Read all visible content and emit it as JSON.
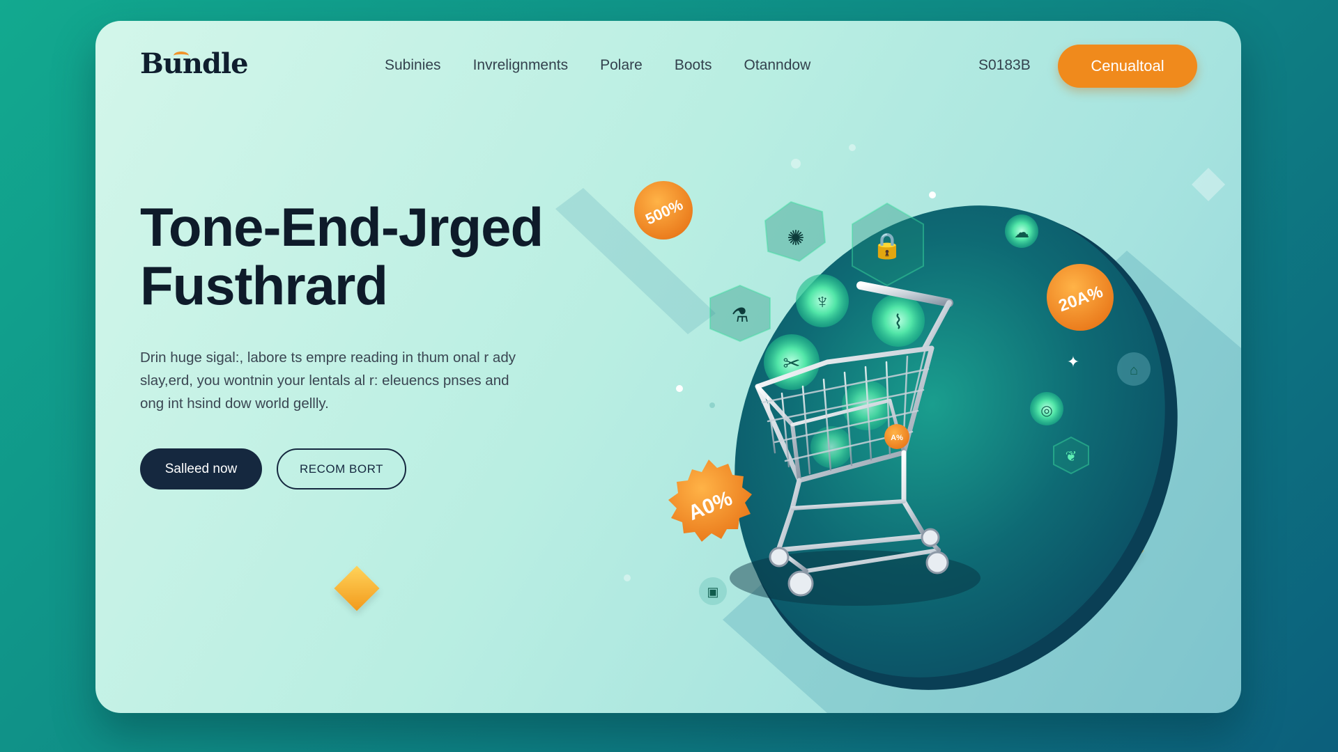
{
  "brand": {
    "name": "Bundle"
  },
  "nav": {
    "links": [
      "Subinies",
      "Invrelignments",
      "Polare",
      "Boots",
      "Otanndow"
    ],
    "promo_code": "S0183B",
    "cta_label": "Cenualtoal"
  },
  "hero": {
    "headline_line1": "Tone-End-Jrged",
    "headline_line2": "Fusthrard",
    "body_line1": "Drin huge sigal:, labore ts empre reading in thum onal r ady",
    "body_line2": "slay,erd, you wontnin your lentals al r: eleuencs pnses and",
    "body_line3": "ong int hsind dow world gellly.",
    "primary_button": "Salleed now",
    "secondary_button": "RECOM BORT"
  },
  "illustration": {
    "badges": [
      "500%",
      "A0%",
      "20A%",
      "A%"
    ],
    "icons": [
      "fan-icon",
      "lock-icon",
      "chat-icon",
      "bottle-icon",
      "antenna-icon",
      "ruler-icon",
      "scissors-icon",
      "tag-icon",
      "coin-icon",
      "gift-icon",
      "leaf-icon"
    ],
    "colors": {
      "accent": "#f08a1c",
      "navy": "#15283f",
      "disk": "#0e6f78",
      "glow": "#47e5a8"
    }
  }
}
